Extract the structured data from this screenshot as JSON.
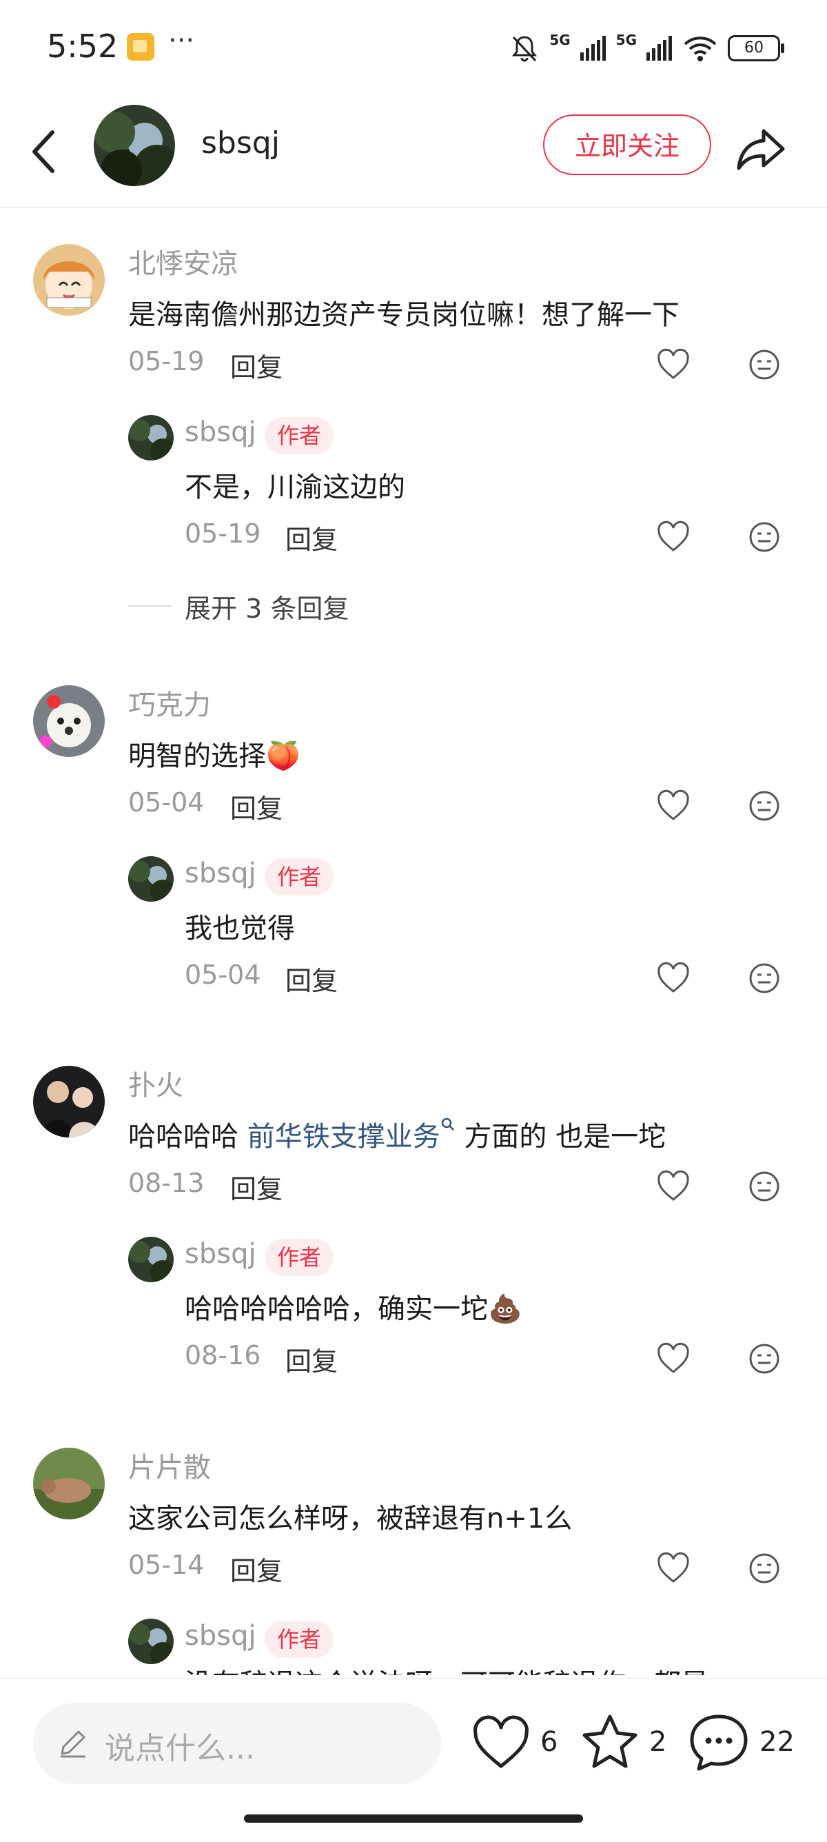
{
  "status_bar": {
    "time": "5:52",
    "more": "···",
    "network1": "5G",
    "network2": "5G",
    "battery": "60"
  },
  "header": {
    "username": "sbsqj",
    "follow_label": "立即关注"
  },
  "comments": [
    {
      "user": "北悸安凉",
      "text": "是海南儋州那边资产专员岗位嘛！想了解一下",
      "date": "05-19",
      "reply_label": "回复",
      "reply": {
        "user": "sbsqj",
        "tag": "作者",
        "text": "不是，川渝这边的",
        "date": "05-19",
        "reply_label": "回复"
      },
      "expand": "展开 3 条回复"
    },
    {
      "user": "巧克力",
      "text": "明智的选择",
      "emoji": "🍑",
      "date": "05-04",
      "reply_label": "回复",
      "reply": {
        "user": "sbsqj",
        "tag": "作者",
        "text": "我也觉得",
        "date": "05-04",
        "reply_label": "回复"
      }
    },
    {
      "user": "扑火",
      "text_before": "哈哈哈哈 ",
      "link": "前华铁支撑业务",
      "link_icon": "search-icon",
      "text_after": " 方面的 也是一坨",
      "date": "08-13",
      "reply_label": "回复",
      "reply": {
        "user": "sbsqj",
        "tag": "作者",
        "text": "哈哈哈哈哈哈，确实一坨",
        "emoji": "💩",
        "date": "08-16",
        "reply_label": "回复"
      }
    },
    {
      "user": "片片散",
      "text": "这家公司怎么样呀，被辞退有n+1么",
      "date": "05-14",
      "reply_label": "回复",
      "reply": {
        "user": "sbsqj",
        "tag": "作者",
        "text": "没有辞退这个说法呀，可可能辞退作，都是"
      }
    }
  ],
  "bottom_bar": {
    "placeholder": "说点什么...",
    "likes": "6",
    "stars": "2",
    "comments": "22"
  },
  "colors": {
    "accent": "#e7354a",
    "tag_bg": "#fdecee",
    "muted": "#9a9a9a",
    "link": "#33557f"
  }
}
